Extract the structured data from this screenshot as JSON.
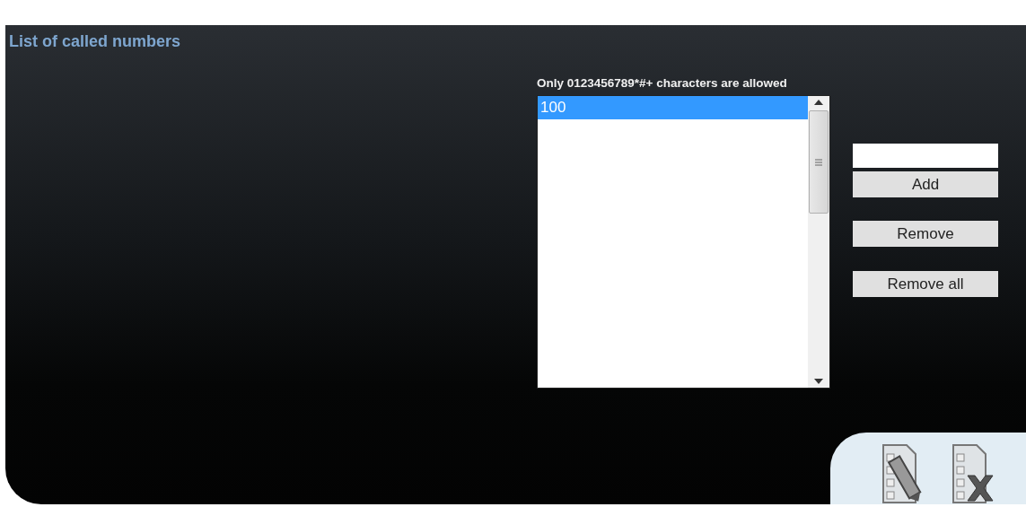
{
  "title": "List of called numbers",
  "hint": "Only 0123456789*#+ characters are allowed",
  "numbers": [
    {
      "label": "100",
      "selected": true
    }
  ],
  "buttons": [
    "Add",
    "Remove",
    "Remove all"
  ]
}
